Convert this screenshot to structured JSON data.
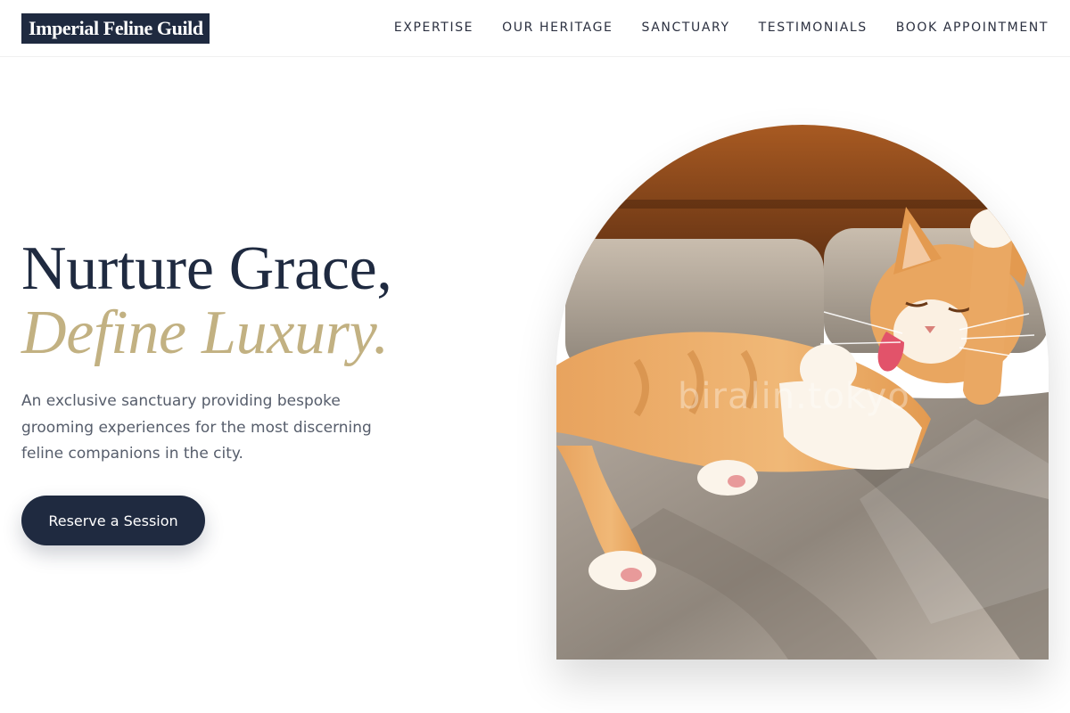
{
  "brand": {
    "name": "Imperial Feline Guild"
  },
  "nav": {
    "items": [
      {
        "label": "EXPERTISE"
      },
      {
        "label": "OUR HERITAGE"
      },
      {
        "label": "SANCTUARY"
      },
      {
        "label": "TESTIMONIALS"
      },
      {
        "label": "BOOK APPOINTMENT"
      }
    ]
  },
  "hero": {
    "title_line1": "Nurture Grace,",
    "title_line2": "Define Luxury.",
    "description": "An exclusive sanctuary providing bespoke grooming experiences for the most discerning feline companions in the city.",
    "cta_label": "Reserve a Session",
    "image": {
      "alt": "orange and white cat on a sofa",
      "watermark": "biralin.tokyo"
    }
  },
  "colors": {
    "navy": "#1f2a40",
    "gold": "#c2b182",
    "body_text": "#565d6b",
    "background": "#ffffff"
  }
}
